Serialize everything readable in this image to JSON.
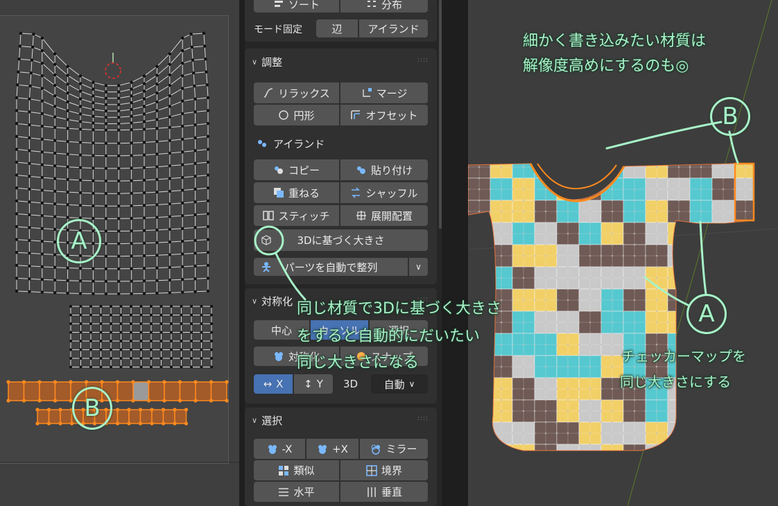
{
  "toolbar_top": {
    "sort": "ソート",
    "distribute": "分布",
    "mode_fix_label": "モード固定",
    "mode_edge": "辺",
    "mode_island": "アイランド"
  },
  "adjust": {
    "title": "調整",
    "relax": "リラックス",
    "merge": "マージ",
    "circle": "円形",
    "offset": "オフセット",
    "island_heading": "アイランド",
    "copy": "コピー",
    "paste": "貼り付け",
    "stack": "重ねる",
    "shuffle": "シャッフル",
    "stitch": "スティッチ",
    "unwrap_place": "展開配置",
    "size_3d": "3Dに基づく大きさ",
    "auto_align": "パーツを自動で整列"
  },
  "symmetry": {
    "title": "対称化",
    "center": "中心",
    "cursor": "カーソル",
    "select": "選択",
    "symmetrize": "対称化",
    "snap": "スナップ",
    "x": "X",
    "y": "Y",
    "label_3d": "3D",
    "mode": "自動"
  },
  "selection": {
    "title": "選択",
    "minus_x": "-X",
    "plus_x": "+X",
    "mirror": "ミラー",
    "similar": "類似",
    "border": "境界",
    "horizontal": "水平",
    "vertical": "垂直"
  },
  "annotations": {
    "top_line1": "細かく書き込みたい材質は",
    "top_line2": "解像度高めにするのも◎",
    "mid_line1": "同じ材質で3Dに基づく大きさ",
    "mid_line2": "をすると自動的にだいたい",
    "mid_line3": "同じ大きさになる",
    "right_line1": "チェッカーマップを",
    "right_line2": "同じ大きさにする",
    "label_a": "A",
    "label_b": "B"
  },
  "colors": {
    "accent": "#a7f3c8",
    "selected": "#ff8a1e",
    "active_button": "#4772b3"
  }
}
